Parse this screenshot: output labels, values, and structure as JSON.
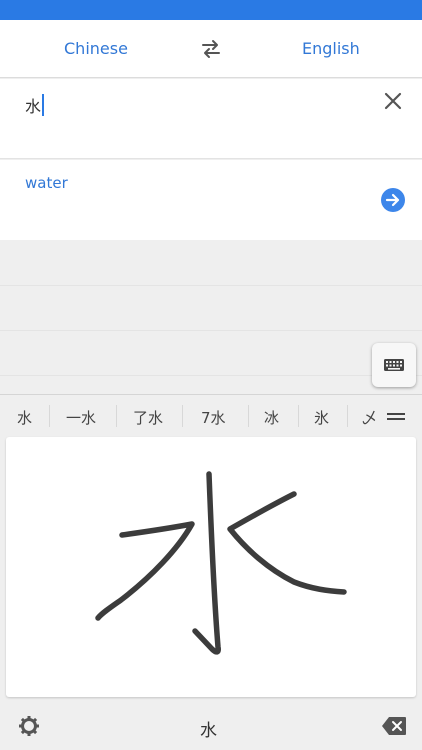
{
  "languages": {
    "source": "Chinese",
    "target": "English"
  },
  "input": {
    "text": "水"
  },
  "output": {
    "text": "water"
  },
  "candidates": [
    "水",
    "一水",
    "了水",
    "7水",
    "冰",
    "氷",
    "乄"
  ],
  "bottom": {
    "preview": "水"
  },
  "icons": {
    "swap": "swap-icon",
    "clear": "close-icon",
    "go": "arrow-right-icon",
    "keyboard": "keyboard-icon",
    "more": "menu-icon",
    "settings": "gear-icon",
    "backspace": "backspace-icon"
  },
  "colors": {
    "accent": "#2a7ae4",
    "link": "#3278d6",
    "stroke": "#3c3c3c"
  }
}
